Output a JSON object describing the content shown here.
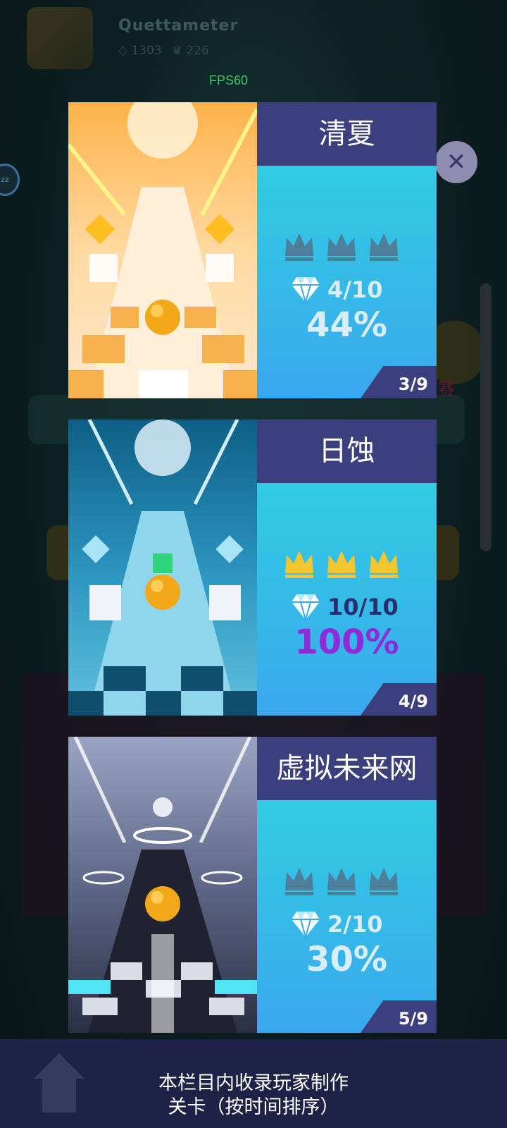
{
  "background": {
    "player_name": "Quettameter",
    "gems": "1303",
    "crowns": "226",
    "side_badge": "zz",
    "red_char": "赛"
  },
  "fps": "FPS60",
  "close_icon": "close-icon",
  "levels": [
    {
      "title": "清夏",
      "crowns_earned": 0,
      "gems": "4/10",
      "percent": "44%",
      "page": "3/9",
      "theme": "orange",
      "crown_color": "#4b7f9a",
      "text_color": "#d9eefa",
      "percent_color": "#d9eefa"
    },
    {
      "title": "日蚀",
      "crowns_earned": 3,
      "gems": "10/10",
      "percent": "100%",
      "page": "4/9",
      "theme": "ice",
      "crown_color": "#f2c531",
      "text_color": "#2d2c6e",
      "percent_color": "#8f2bd8"
    },
    {
      "title": "虚拟未来网",
      "crowns_earned": 0,
      "gems": "2/10",
      "percent": "30%",
      "page": "5/9",
      "theme": "cyber",
      "crown_color": "#4b7f9a",
      "text_color": "#d9eefa",
      "percent_color": "#d9eefa"
    }
  ],
  "footer": {
    "line1": "本栏目内收录玩家制作",
    "line2": "关卡（按时间排序）",
    "home_icon": "home-icon"
  }
}
